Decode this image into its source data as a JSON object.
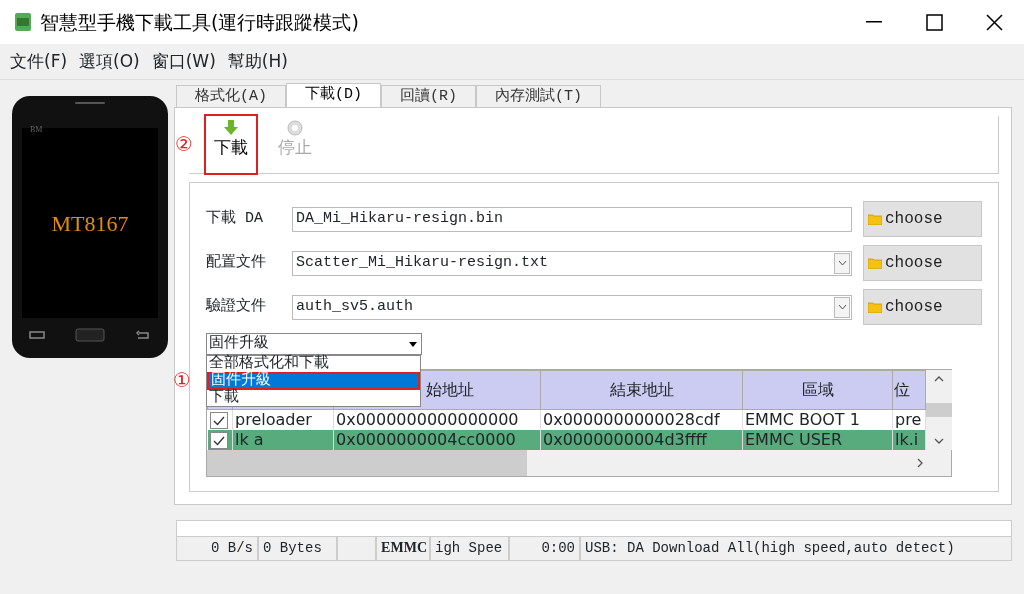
{
  "window": {
    "title": "智慧型手機下載工具(運行時跟蹤模式)"
  },
  "menu": [
    "文件(F)",
    "選項(O)",
    "窗口(W)",
    "幫助(H)"
  ],
  "device": {
    "brand": "BM",
    "chip": "MT8167"
  },
  "tabs": [
    {
      "label": "格式化(A)",
      "selected": false
    },
    {
      "label": "下載(D)",
      "selected": true
    },
    {
      "label": "回讀(R)",
      "selected": false
    },
    {
      "label": "內存測試(T)",
      "selected": false
    }
  ],
  "toolbar": [
    {
      "kind": "download",
      "label": "下載",
      "disabled": false,
      "annotation": "②"
    },
    {
      "kind": "stop",
      "label": "停止",
      "disabled": true
    }
  ],
  "fields": [
    {
      "kind": "text",
      "label": "下載 DA",
      "value": "DA_Mi_Hikaru-resign.bin",
      "button": "choose"
    },
    {
      "kind": "combo",
      "label": "配置文件",
      "value": "Scatter_Mi_Hikaru-resign.txt",
      "button": "choose"
    },
    {
      "kind": "combo",
      "label": "驗證文件",
      "value": "auth_sv5.auth",
      "button": "choose"
    }
  ],
  "mode_select": {
    "value": "固件升級",
    "options": [
      {
        "label": "全部格式化和下載",
        "selected": false
      },
      {
        "label": "固件升級",
        "selected": true,
        "annotation": "①"
      },
      {
        "label": "下載",
        "selected": false
      }
    ]
  },
  "table": {
    "columns": [
      null,
      "始地址",
      "結束地址",
      "區域",
      "位"
    ],
    "rows": [
      {
        "checked": true,
        "selected": false,
        "cells": [
          "preloader",
          "0x0000000000000000",
          "0x0000000000028cdf",
          "EMMC BOOT 1",
          "pre"
        ]
      },
      {
        "checked": true,
        "selected": true,
        "cells": [
          "lk a",
          "0x0000000004cc0000",
          "0x0000000004d3ffff",
          "EMMC USER",
          "lk.i"
        ]
      }
    ]
  },
  "progress": {
    "level": 0
  },
  "status_bar": [
    {
      "text": "0 B/s",
      "bold": false
    },
    {
      "text": "0 Bytes",
      "bold": false
    },
    {
      "text": "EMMC",
      "bold": true
    },
    {
      "text": "igh Spee",
      "bold": false
    },
    {
      "text": "0:00",
      "bold": false
    },
    {
      "text": "USB: DA Download All(high speed,auto detect)",
      "bold": false
    }
  ]
}
